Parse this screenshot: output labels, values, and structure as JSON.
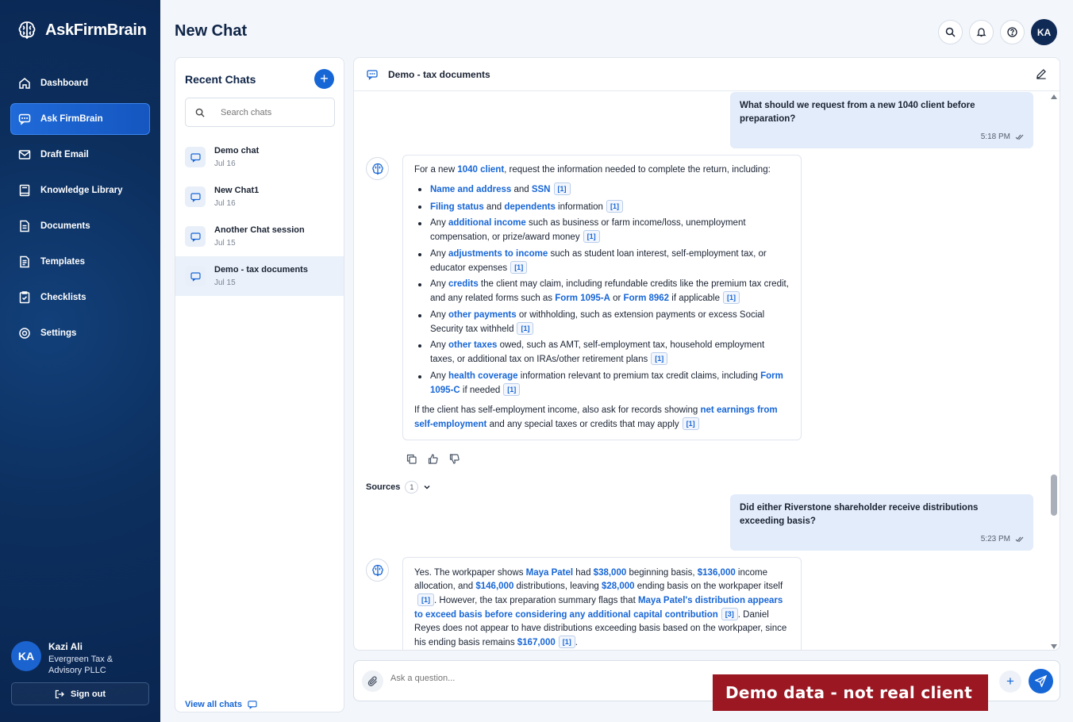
{
  "brand": {
    "name": "AskFirmBrain"
  },
  "sidebar": {
    "items": [
      {
        "label": "Dashboard",
        "icon": "home-icon"
      },
      {
        "label": "Ask FirmBrain",
        "icon": "chat-icon",
        "active": true
      },
      {
        "label": "Draft Email",
        "icon": "mail-icon"
      },
      {
        "label": "Knowledge Library",
        "icon": "book-icon"
      },
      {
        "label": "Documents",
        "icon": "document-icon"
      },
      {
        "label": "Templates",
        "icon": "template-icon"
      },
      {
        "label": "Checklists",
        "icon": "checklist-icon"
      },
      {
        "label": "Settings",
        "icon": "gear-icon"
      }
    ],
    "user": {
      "initials": "KA",
      "name": "Kazi Ali",
      "org": "Evergreen Tax & Advisory PLLC"
    },
    "signout_label": "Sign out"
  },
  "header": {
    "title": "New Chat",
    "avatar_initials": "KA"
  },
  "recent_chats": {
    "title": "Recent Chats",
    "search_placeholder": "Search chats",
    "items": [
      {
        "name": "Demo chat",
        "date": "Jul 16"
      },
      {
        "name": "New Chat1",
        "date": "Jul 16"
      },
      {
        "name": "Another Chat session",
        "date": "Jul 15"
      },
      {
        "name": "Demo - tax documents",
        "date": "Jul 15",
        "active": true
      }
    ],
    "view_all_label": "View all chats"
  },
  "conversation": {
    "title": "Demo - tax documents",
    "messages": {
      "user1": {
        "text": "What should we request from a new 1040 client before preparation?",
        "time": "5:18 PM"
      },
      "bot1": {
        "intro_a": "For a new ",
        "intro_hl": "1040 client",
        "intro_b": ", request the information needed to complete the return, including:",
        "b1_hl1": "Name and address",
        "b1_t1": " and ",
        "b1_hl2": "SSN",
        "b2_hl1": "Filing status",
        "b2_t1": " and ",
        "b2_hl2": "dependents",
        "b2_t2": " information",
        "b3_t1": "Any ",
        "b3_hl": "additional income",
        "b3_t2": " such as business or farm income/loss, unemployment compensation, or prize/award money",
        "b4_t1": "Any ",
        "b4_hl": "adjustments to income",
        "b4_t2": " such as student loan interest, self-employment tax, or educator expenses",
        "b5_t1": "Any ",
        "b5_hl": "credits",
        "b5_t2": " the client may claim, including refundable credits like the premium tax credit, and any related forms such as ",
        "b5_hl2": "Form 1095-A",
        "b5_t3": " or ",
        "b5_hl3": "Form 8962",
        "b5_t4": " if applicable",
        "b6_t1": "Any ",
        "b6_hl": "other payments",
        "b6_t2": " or withholding, such as extension payments or excess Social Security tax withheld",
        "b7_t1": "Any ",
        "b7_hl": "other taxes",
        "b7_t2": " owed, such as AMT, self-employment tax, household employment taxes, or additional tax on IRAs/other retirement plans",
        "b8_t1": "Any ",
        "b8_hl": "health coverage",
        "b8_t2": " information relevant to premium tax credit claims, including ",
        "b8_hl2": "Form 1095-C",
        "b8_t3": " if needed",
        "outro_a": "If the client has self-employment income, also ask for records showing ",
        "outro_hl": "net earnings from self-employment",
        "outro_b": " and any special taxes or credits that may apply",
        "cite": "[1]"
      },
      "sources": {
        "label": "Sources",
        "count": "1"
      },
      "user2": {
        "text": "Did either Riverstone shareholder receive distributions exceeding basis?",
        "time": "5:23 PM"
      },
      "bot2": {
        "t1": "Yes. The workpaper shows ",
        "hl1": "Maya Patel",
        "t2": " had ",
        "hl2": "$38,000",
        "t3": " beginning basis, ",
        "hl3": "$136,000",
        "t4": " income allocation, and ",
        "hl4": "$146,000",
        "t5": " distributions, leaving ",
        "hl5": "$28,000",
        "t6": " ending basis on the workpaper itself",
        "cite1": "[1]",
        "t7": ". However, the tax preparation summary flags that ",
        "hl6": "Maya Patel's distribution appears to exceed basis before considering any additional capital contribution",
        "cite3": "[3]",
        "t8": ". Daniel Reyes does not appear to have distributions exceeding basis based on the workpaper, since his ending basis remains ",
        "hl7": "$167,000",
        "t9": "."
      }
    }
  },
  "composer": {
    "placeholder": "Ask a question..."
  },
  "banner": {
    "text": "Demo data - not real client"
  },
  "colors": {
    "accent": "#1766d6",
    "sidebar": "#0c2f5e",
    "banner": "#9b1823"
  }
}
